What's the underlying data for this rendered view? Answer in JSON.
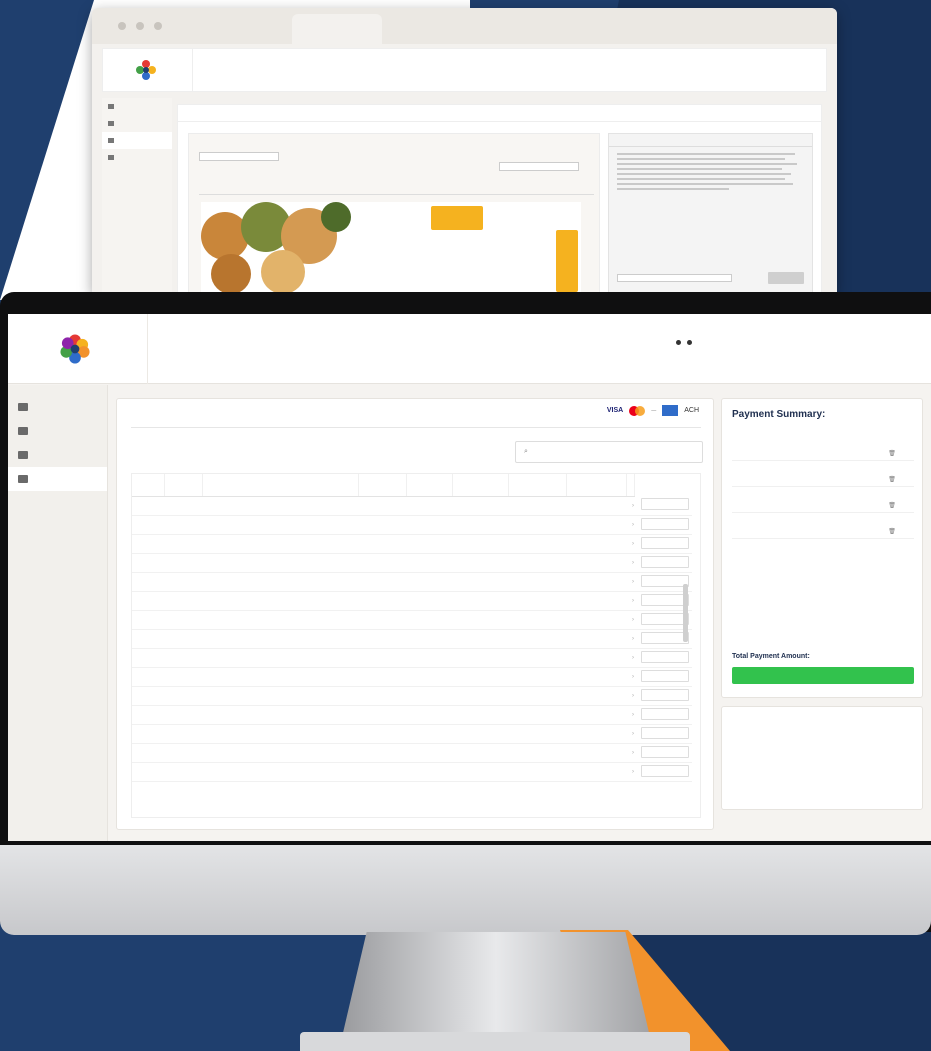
{
  "back_window": {
    "breadcrumb": "",
    "tab_selected": "",
    "right_tabs": [
      "",
      "",
      ""
    ]
  },
  "header": {
    "logo_line1": "",
    "logo_line2": "",
    "account_label": "",
    "account_value": "",
    "billing_label": "",
    "billing_value": "",
    "customer_label": "",
    "customer_line": "",
    "customer_contact": ""
  },
  "sidebar": {
    "items": [
      {
        "label": "",
        "icon": "home-icon"
      },
      {
        "label": "",
        "icon": "orders-icon"
      },
      {
        "label": "",
        "icon": "users-icon"
      },
      {
        "label": "",
        "icon": "billing-icon"
      }
    ]
  },
  "main": {
    "tabs": [
      "",
      ""
    ],
    "payment_methods": {
      "visa": "VISA",
      "amex": "",
      "ach": "ACH"
    },
    "search_placeholder": "",
    "columns": [
      "",
      "",
      "",
      "",
      "",
      "",
      "",
      ""
    ],
    "rows": [
      {
        "inv": "",
        "brand": "",
        "desc": "",
        "c4": "",
        "c5": "",
        "c6": "",
        "c7": "",
        "c8": "",
        "pay": "",
        "pay_status": "ok"
      },
      {
        "inv": "",
        "brand": "",
        "desc": "",
        "c4": "",
        "c5": "",
        "c6": "",
        "c7": "",
        "c8": "",
        "pay": "",
        "pay_status": ""
      },
      {
        "inv": "",
        "brand": "",
        "desc": "",
        "c4": "",
        "c5": "",
        "c6": "",
        "c7": "",
        "c8": "",
        "pay": "",
        "pay_status": "ok"
      },
      {
        "inv": "",
        "brand": "",
        "desc": "",
        "c4": "",
        "c5": "",
        "c6": "",
        "c7": "",
        "c8": "",
        "pay": "",
        "pay_status": ""
      },
      {
        "inv": "",
        "brand": "",
        "desc": "",
        "c4": "",
        "c5": "",
        "c6": "",
        "c7": "",
        "c8": "",
        "pay": "",
        "pay_status": ""
      },
      {
        "inv": "",
        "brand": "",
        "desc": "",
        "c4": "",
        "c5": "",
        "c6": "",
        "c7": "",
        "c8": "",
        "pay": "",
        "pay_status": ""
      },
      {
        "inv": "",
        "brand": "",
        "desc": "",
        "c4": "",
        "c5": "",
        "c6": "",
        "c7": "",
        "c8": "",
        "pay": "",
        "pay_status": "warn"
      },
      {
        "inv": "",
        "brand": "",
        "desc": "",
        "c4": "",
        "c5": "",
        "c6": "",
        "c7": "",
        "c8": "",
        "pay": "",
        "pay_status": ""
      },
      {
        "inv": "",
        "brand": "",
        "desc": "",
        "c4": "",
        "c5": "",
        "c6": "",
        "c7": "",
        "c8": "",
        "pay": "",
        "pay_status": "ok"
      },
      {
        "inv": "",
        "brand": "",
        "desc": "",
        "c4": "",
        "c5": "",
        "c6": "",
        "c7": "",
        "c8": "",
        "pay": "",
        "pay_status": ""
      },
      {
        "inv": "",
        "brand": "",
        "desc": "",
        "c4": "",
        "c5": "",
        "c6": "",
        "c7": "",
        "c8": "",
        "pay": "",
        "pay_status": ""
      },
      {
        "inv": "",
        "brand": "",
        "desc": "",
        "c4": "",
        "c5": "",
        "c6": "",
        "c7": "",
        "c8": "",
        "pay": "",
        "pay_status": ""
      },
      {
        "inv": "",
        "brand": "",
        "desc": "",
        "c4": "",
        "c5": "",
        "c6": "",
        "c7": "",
        "c8": "",
        "pay": "",
        "pay_status": ""
      },
      {
        "inv": "",
        "brand": "",
        "desc": "",
        "c4": "",
        "c5": "",
        "c6": "",
        "c7": "",
        "c8": "",
        "pay": "",
        "pay_status": ""
      },
      {
        "inv": "",
        "brand": "",
        "desc": "",
        "c4": "",
        "c5": "",
        "c6": "",
        "c7": "",
        "c8": "",
        "pay": "",
        "pay_status": ""
      }
    ]
  },
  "summary": {
    "title": "Payment Summary:",
    "columns": [
      "",
      "",
      ""
    ],
    "rows": [
      {
        "a": "",
        "b": "",
        "c": ""
      },
      {
        "a": "",
        "b": "",
        "c": ""
      },
      {
        "a": "",
        "b": "",
        "c": ""
      },
      {
        "a": "",
        "b": "",
        "c": ""
      }
    ],
    "total_label": "Total Payment Amount:",
    "pay_button": ""
  },
  "terms": {
    "payment_terms_label": "",
    "payment_terms_value": "",
    "open_invoices_label": "",
    "open_invoices_value": "",
    "total_due_label": "",
    "total_due_value": "",
    "aging": [
      {
        "label": "",
        "value": ""
      },
      {
        "label": "",
        "value": ""
      },
      {
        "label": "",
        "value": ""
      },
      {
        "label": "",
        "value": ""
      }
    ]
  },
  "colors": {
    "brand_navy": "#1f3f6e",
    "accent_blue": "#2f6cc9",
    "pay_green": "#32c24d",
    "orange": "#f2922c"
  }
}
